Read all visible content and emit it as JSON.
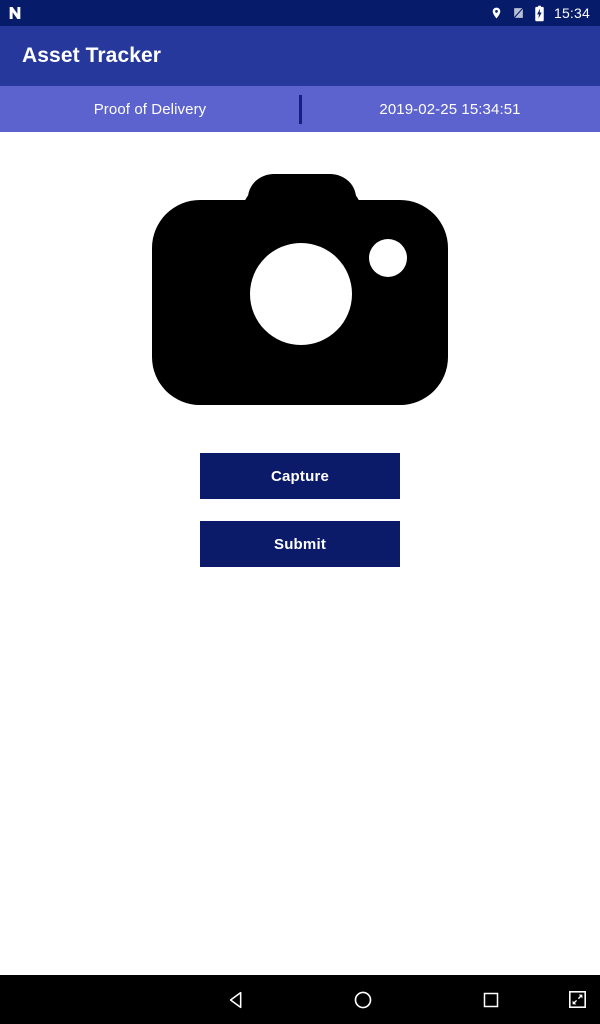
{
  "status_bar": {
    "background": "#071B6B",
    "notification_icon": "android-n-icon",
    "icons": [
      "location-pin-icon",
      "no-sim-icon",
      "battery-charging-icon"
    ],
    "clock": "15:34"
  },
  "app_bar": {
    "background": "#26389B",
    "title": "Asset Tracker"
  },
  "sub_header": {
    "background": "#5C62CE",
    "divider_color": "#16207A",
    "screen_label": "Proof of Delivery",
    "timestamp": "2019-02-25 15:34:51"
  },
  "content": {
    "background": "#FFFFFF",
    "photo_placeholder_icon": "camera-icon",
    "photo_placeholder_color": "#000000"
  },
  "actions": {
    "button_color": "#0B1B69",
    "button_text_color": "#FFFFFF",
    "capture_label": "Capture",
    "submit_label": "Submit"
  },
  "nav_bar": {
    "background": "#000000",
    "buttons": [
      {
        "name": "back-icon",
        "label": "Back"
      },
      {
        "name": "home-icon",
        "label": "Home"
      },
      {
        "name": "recents-icon",
        "label": "Recents"
      },
      {
        "name": "screenshot-icon",
        "label": "Screenshot"
      }
    ]
  }
}
